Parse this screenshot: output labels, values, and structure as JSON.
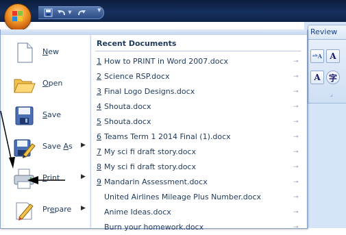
{
  "ribbon": {
    "tab_label": "Review"
  },
  "qat": {
    "items": [
      {
        "icon": "save-icon"
      },
      {
        "icon": "undo-icon"
      },
      {
        "icon": "redo-icon"
      },
      {
        "icon": "customize-icon"
      }
    ]
  },
  "menu": {
    "left_items": [
      {
        "label": "New",
        "accel": "N",
        "icon": "new-document-icon",
        "has_submenu": false
      },
      {
        "label": "Open",
        "accel": "O",
        "icon": "open-folder-icon",
        "has_submenu": false
      },
      {
        "label": "Save",
        "accel": "S",
        "icon": "save-disk-icon",
        "has_submenu": false
      },
      {
        "label": "Save As",
        "accel": "A",
        "icon": "save-as-icon",
        "has_submenu": true
      },
      {
        "label": "Print",
        "accel": "P",
        "icon": "printer-icon",
        "has_submenu": true
      },
      {
        "label": "Prepare",
        "accel": "e",
        "icon": "prepare-icon",
        "has_submenu": true
      }
    ],
    "recent": {
      "title": "Recent Documents",
      "documents": [
        {
          "num": "1",
          "name": "How to PRINT in Word 2007.docx"
        },
        {
          "num": "2",
          "name": "Science RSP.docx"
        },
        {
          "num": "3",
          "name": "Final Logo Designs.docx"
        },
        {
          "num": "4",
          "name": "Shouta.docx"
        },
        {
          "num": "5",
          "name": "Shouta.docx"
        },
        {
          "num": "6",
          "name": "Teams Term 1 2014 Final (1).docx"
        },
        {
          "num": "7",
          "name": "My sci fi draft story.docx"
        },
        {
          "num": "8",
          "name": "My sci fi draft story.docx"
        },
        {
          "num": "9",
          "name": "Mandarin Assessment.docx"
        },
        {
          "num": "",
          "name": "United Airlines Mileage Plus Number.docx"
        },
        {
          "num": "",
          "name": "Anime Ideas.docx"
        },
        {
          "num": "",
          "name": "Burn your homework.docx"
        }
      ]
    }
  },
  "colors": {
    "title_bar": "#16305e",
    "menu_text": "#1e395b",
    "accent_orange": "#f39a2b"
  }
}
